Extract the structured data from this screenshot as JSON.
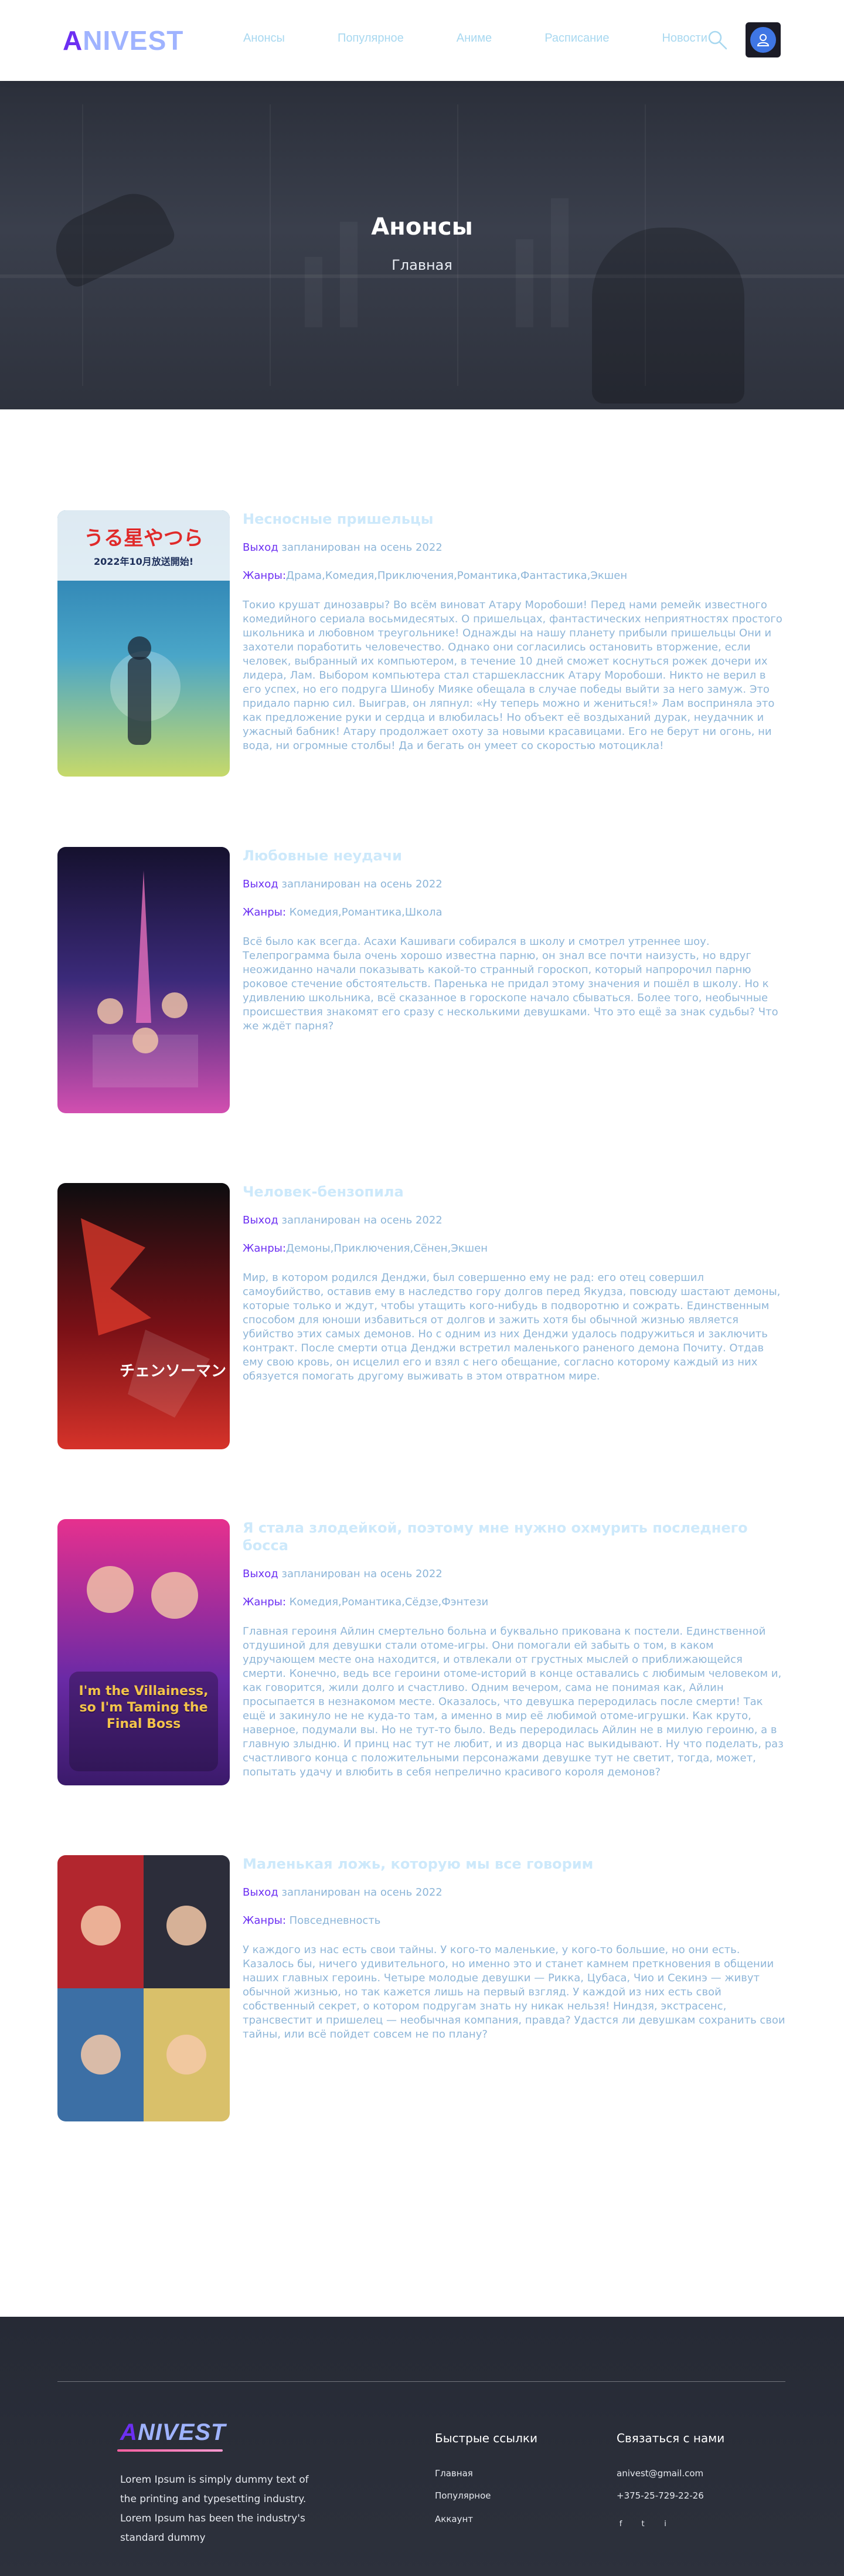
{
  "header": {
    "logo_first": "A",
    "logo_rest": "NIVEST",
    "nav": [
      "Анонсы",
      "Популярное",
      "Аниме",
      "Расписание",
      "Новости"
    ]
  },
  "hero": {
    "title": "Анонсы",
    "breadcrumb": "Главная"
  },
  "labels": {
    "release": "Выход",
    "genres": "Жанры:"
  },
  "items": [
    {
      "title": "Несносные пришельцы",
      "release": "запланирован на осень 2022",
      "genres": "Драма,Комедия,Приключения,Романтика,Фантастика,Экшен",
      "description": "Токио крушат динозавры? Во всём виноват Атару Моробоши! Перед нами ремейк известного комедийного сериала восьмидесятых. О пришельцах, фантастических неприятностях простого школьника и любовном треугольнике! Однажды на нашу планету прибыли пришельцы Они и захотели поработить человечество. Однако они согласились остановить вторжение, если человек, выбранный их компьютером, в течение 10 дней сможет коснуться рожек дочери их лидера, Лам. Выбором компьютера стал старшеклассник Атару Моробоши. Никто не верил в его успех, но его подруга Шинобу Мияке обещала в случае победы выйти за него замуж. Это придало парню сил. Выиграв, он ляпнул: «Ну теперь можно и жениться!» Лам восприняла это как предложение руки и сердца и влюбилась! Но объект её воздыханий дурак, неудачник и ужасный бабник! Атару продолжает охоту за новыми красавицами. Его не берут ни огонь, ни вода, ни огромные столбы! Да и бегать он умеет со скоростью мотоцикла!",
      "poster_text": "うる星やつら",
      "poster_sub": "2022年10月放送開始!",
      "colors": [
        "#1f6fa8",
        "#4aa6c8",
        "#c6d96a"
      ]
    },
    {
      "title": "Любовные неудачи",
      "release": "запланирован на осень 2022",
      "genres": "Комедия,Романтика,Школа",
      "description": "Всё было как всегда. Асахи Кашиваги собирался в школу и смотрел утреннее шоу. Телепрограмма была очень хорошо известна парню, он знал все почти наизусть, но вдруг неожиданно начали показывать какой-то странный гороскоп, который напророчил парню роковое стечение обстоятельств. Паренька не придал этому значения и пошёл в школу. Но к удивлению школьника, всё сказанное в гороскопе начало сбываться. Более того, необычные происшествия знакомят его сразу с несколькими девушками. Что это ещё за знак судьбы? Что же ждёт парня?",
      "poster_text": "",
      "poster_sub": "",
      "colors": [
        "#15112e",
        "#3b2a7a",
        "#d24fb0"
      ]
    },
    {
      "title": "Человек-бензопила",
      "release": "запланирован на осень 2022",
      "genres": "Демоны,Приключения,Сёнен,Экшен",
      "description": "Мир, в котором родился Денджи, был совершенно ему не рад: его отец совершил самоубийство, оставив ему в наследство гору долгов перед Якудза, повсюду шастают демоны, которые только и ждут, чтобы утащить кого-нибудь в подворотню и сожрать. Единственным способом для юноши избавиться от долгов и зажить хотя бы обычной жизнью является убийство этих самых демонов. Но с одним из них Денджи удалось подружиться и заключить контракт. После смерти отца Денджи встретил маленького раненого демона Почиту. Отдав ему свою кровь, он исцелил его и взял с него обещание, согласно которому каждый из них обязуется помогать другому выживать в этом отвратном мире.",
      "poster_text": "チェンソーマン",
      "poster_sub": "",
      "colors": [
        "#0d0d0f",
        "#7a1016",
        "#d6332a"
      ]
    },
    {
      "title": "Я стала злодейкой, поэтому мне нужно охмурить последнего босса",
      "release": "запланирован на осень 2022",
      "genres": "Комедия,Романтика,Сёдзе,Фэнтези",
      "description": "Главная героиня Айлин смертельно больна и буквально прикована к постели. Единственной отдушиной для девушки стали отоме-игры. Они помогали ей забыть о том, в каком удручающем месте она находится, и отвлекали от грустных мыслей о приближающейся смерти. Конечно, ведь все героини отоме-историй в конце оставались с любимым человеком и, как говорится, жили долго и счастливо. Одним вечером, сама не понимая как, Айлин просыпается в незнакомом месте. Оказалось, что девушка переродилась после смерти! Так ещё и закинуло не не куда-то там, а именно в мир её любимой отоме-игрушки. Как круто, наверное, подумали вы. Но не тут-то было. Ведь переродилась Айлин не в милую героиню, а в главную злыдню. И принц нас тут не любит, и из дворца нас выкидывают. Ну что поделать, раз счастливого конца с положительными персонажами девушке тут не светит, тогда, может, попытать удачу и влюбить в себя непрелично красивого короля демонов?",
      "poster_text": "I'm the Villainess, so I'm Taming the Final Boss",
      "poster_sub": "",
      "colors": [
        "#e6308e",
        "#6a2aa6",
        "#f3c34a"
      ]
    },
    {
      "title": "Маленькая ложь, которую мы все говорим",
      "release": "запланирован на осень 2022",
      "genres": "Повседневность",
      "description": "У каждого из нас есть свои тайны. У кого-то маленькие, у кого-то большие, но они есть. Казалось бы, ничего удивительного, но именно это и станет камнем преткновения в общении наших главных героинь. Четыре молодые девушки — Рикка, Цубаса, Чио и Секинэ — живут обычной жизнью, но так кажется лишь на первый взгляд. У каждой из них есть свой собственный секрет, о котором подругам знать ну никак нельзя! Ниндзя, экстрасенс, трансвестит и пришелец — необычная компания, правда? Удастся ли девушкам сохранить свои тайны, или всё пойдет совсем не по плану?",
      "poster_text": "",
      "poster_sub": "",
      "colors": [
        "#b2262e",
        "#2c2d3a",
        "#d9c06a"
      ]
    }
  ],
  "footer": {
    "logo_first": "A",
    "logo_rest": "NIVEST",
    "about": "Lorem Ipsum is simply dummy text of the printing and typesetting industry. Lorem Ipsum has been the industry's standard dummy",
    "quick_links_title": "Быстрые ссылки",
    "quick_links": [
      "Главная",
      "Популярное",
      "Аккаунт"
    ],
    "contact_title": "Связаться с нами",
    "email": "anivest@gmail.com",
    "phone": "+375-25-729-22-26",
    "social": [
      "f",
      "t",
      "i"
    ]
  }
}
